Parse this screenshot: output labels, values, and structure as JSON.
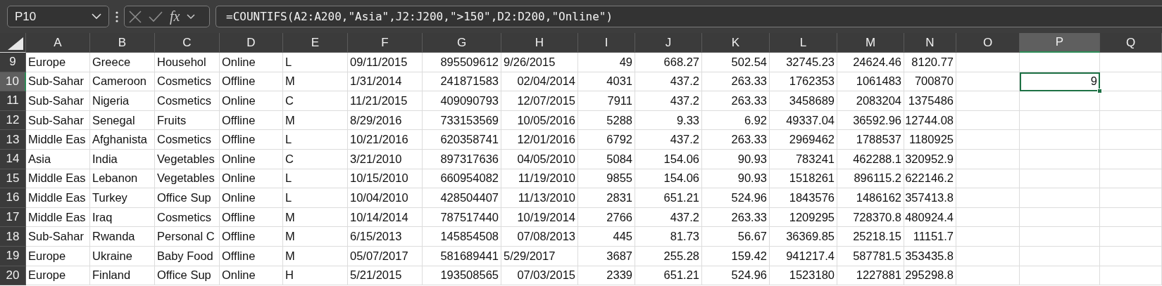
{
  "name_box": {
    "value": "P10"
  },
  "formula_bar": {
    "function_label": "fx",
    "formula": "=COUNTIFS(A2:A200,\"Asia\",J2:J200,\">150\",D2:D200,\"Online\")"
  },
  "columns": [
    {
      "label": "A",
      "selected": false,
      "kind": "text"
    },
    {
      "label": "B",
      "selected": false,
      "kind": "text"
    },
    {
      "label": "C",
      "selected": false,
      "kind": "text"
    },
    {
      "label": "D",
      "selected": false,
      "kind": "text"
    },
    {
      "label": "E",
      "selected": false,
      "kind": "text"
    },
    {
      "label": "F",
      "selected": false,
      "kind": "text"
    },
    {
      "label": "G",
      "selected": false,
      "kind": "number"
    },
    {
      "label": "H",
      "selected": false,
      "kind": "number"
    },
    {
      "label": "I",
      "selected": false,
      "kind": "number"
    },
    {
      "label": "J",
      "selected": false,
      "kind": "number"
    },
    {
      "label": "K",
      "selected": false,
      "kind": "number"
    },
    {
      "label": "L",
      "selected": false,
      "kind": "number"
    },
    {
      "label": "M",
      "selected": false,
      "kind": "number"
    },
    {
      "label": "N",
      "selected": false,
      "kind": "number"
    },
    {
      "label": "O",
      "selected": false
    },
    {
      "label": "P",
      "selected": true,
      "kind": "number"
    },
    {
      "label": "Q",
      "selected": false
    }
  ],
  "rows": [
    {
      "number": "9",
      "selected": false,
      "cells": [
        "Europe",
        "Greece",
        "Househol",
        "Online",
        "L",
        "09/11/2015",
        "895509612",
        {
          "text": "9/26/2015",
          "kind": "text"
        },
        "49",
        "668.27",
        "502.54",
        "32745.23",
        "24624.46",
        "8120.77"
      ]
    },
    {
      "number": "10",
      "selected": true,
      "cells": [
        "Sub-Sahar",
        "Cameroon",
        "Cosmetics",
        "Offline",
        "M",
        "1/31/2014",
        "241871583",
        "02/04/2014",
        "4031",
        "437.2",
        "263.33",
        "1762353",
        "1061483",
        "700870"
      ],
      "active_cell": {
        "value": "9"
      }
    },
    {
      "number": "11",
      "selected": false,
      "cells": [
        "Sub-Sahar",
        "Nigeria",
        "Cosmetics",
        "Online",
        "C",
        "11/21/2015",
        "409090793",
        "12/07/2015",
        "7911",
        "437.2",
        "263.33",
        "3458689",
        "2083204",
        "1375486"
      ]
    },
    {
      "number": "12",
      "selected": false,
      "cells": [
        "Sub-Sahar",
        "Senegal",
        "Fruits",
        "Offline",
        "M",
        "8/29/2016",
        "733153569",
        "10/05/2016",
        "5288",
        "9.33",
        "6.92",
        "49337.04",
        "36592.96",
        "12744.08"
      ]
    },
    {
      "number": "13",
      "selected": false,
      "cells": [
        "Middle Eas",
        "Afghanista",
        "Cosmetics",
        "Offline",
        "L",
        "10/21/2016",
        "620358741",
        "12/01/2016",
        "6792",
        "437.2",
        "263.33",
        "2969462",
        "1788537",
        "1180925"
      ]
    },
    {
      "number": "14",
      "selected": false,
      "cells": [
        "Asia",
        "India",
        "Vegetables",
        "Online",
        "C",
        "3/21/2010",
        "897317636",
        "04/05/2010",
        "5084",
        "154.06",
        "90.93",
        "783241",
        "462288.1",
        "320952.9"
      ]
    },
    {
      "number": "15",
      "selected": false,
      "cells": [
        "Middle Eas",
        "Lebanon",
        "Vegetables",
        "Online",
        "L",
        "10/15/2010",
        "660954082",
        "11/19/2010",
        "9855",
        "154.06",
        "90.93",
        "1518261",
        "896115.2",
        "622146.2"
      ]
    },
    {
      "number": "16",
      "selected": false,
      "cells": [
        "Middle Eas",
        "Turkey",
        "Office Sup",
        "Online",
        "L",
        "10/04/2010",
        "428504407",
        "11/13/2010",
        "2831",
        "651.21",
        "524.96",
        "1843576",
        "1486162",
        "357413.8"
      ]
    },
    {
      "number": "17",
      "selected": false,
      "cells": [
        "Middle Eas",
        "Iraq",
        "Cosmetics",
        "Offline",
        "M",
        "10/14/2014",
        "787517440",
        "10/19/2014",
        "2766",
        "437.2",
        "263.33",
        "1209295",
        "728370.8",
        "480924.4"
      ]
    },
    {
      "number": "18",
      "selected": false,
      "cells": [
        "Sub-Sahar",
        "Rwanda",
        "Personal C",
        "Offline",
        "M",
        "6/15/2013",
        "145854508",
        "07/08/2013",
        "445",
        "81.73",
        "56.67",
        "36369.85",
        "25218.15",
        "11151.7"
      ]
    },
    {
      "number": "19",
      "selected": false,
      "cells": [
        "Europe",
        "Ukraine",
        "Baby Food",
        "Offline",
        "M",
        "05/07/2017",
        "581689441",
        {
          "text": "5/29/2017",
          "kind": "text"
        },
        "3687",
        "255.28",
        "159.42",
        "941217.4",
        "587781.5",
        "353435.8"
      ]
    },
    {
      "number": "20",
      "selected": false,
      "cells": [
        "Europe",
        "Finland",
        "Office Sup",
        "Online",
        "H",
        "5/21/2015",
        "193508565",
        "07/03/2015",
        "2339",
        "651.21",
        "524.96",
        "1523180",
        "1227881",
        "295298.8"
      ]
    }
  ]
}
